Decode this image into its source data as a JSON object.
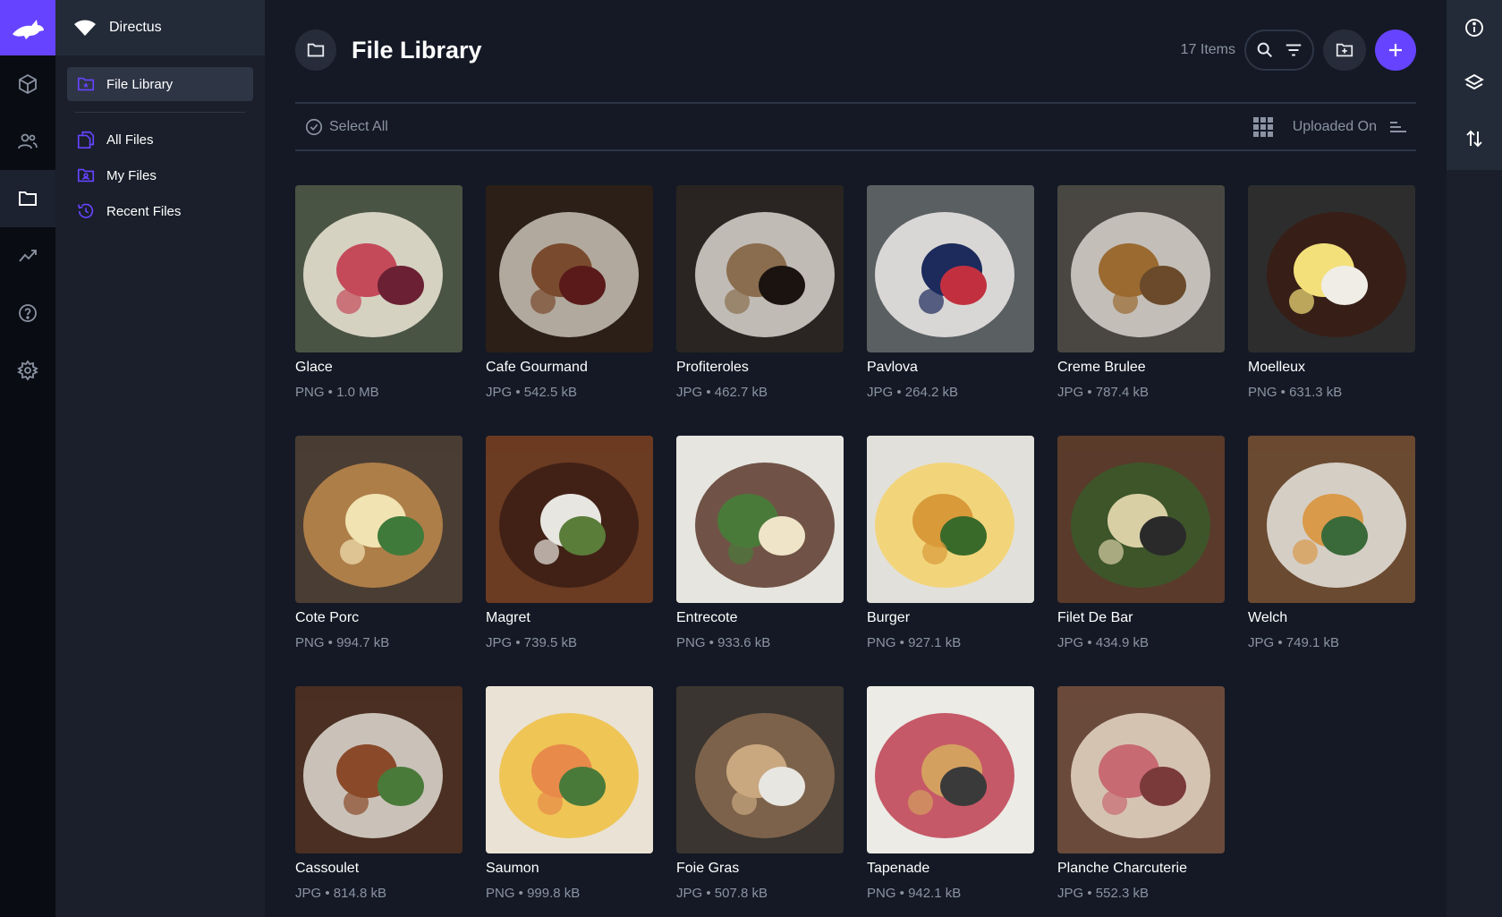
{
  "project": {
    "name": "Directus"
  },
  "modules": [
    "content-icon",
    "users-icon",
    "files-icon",
    "insights-icon",
    "help-icon",
    "settings-icon"
  ],
  "nav": {
    "header_item": "File Library",
    "items": [
      {
        "label": "All Files",
        "icon": "files-stack-icon"
      },
      {
        "label": "My Files",
        "icon": "user-folder-icon"
      },
      {
        "label": "Recent Files",
        "icon": "history-icon"
      }
    ]
  },
  "header": {
    "title": "File Library",
    "count": "17 Items"
  },
  "toolbar": {
    "select_all": "Select All",
    "sort_label": "Uploaded On"
  },
  "colors": {
    "accent": "#6644ff",
    "background": "#141925",
    "nav": "#1a1f2b",
    "modbar": "#090c12"
  },
  "files": [
    {
      "title": "Glace",
      "meta": "PNG • 1.0 MB"
    },
    {
      "title": "Cafe Gourmand",
      "meta": "JPG • 542.5 kB"
    },
    {
      "title": "Profiteroles",
      "meta": "JPG • 462.7 kB"
    },
    {
      "title": "Pavlova",
      "meta": "JPG • 264.2 kB"
    },
    {
      "title": "Creme Brulee",
      "meta": "JPG • 787.4 kB"
    },
    {
      "title": "Moelleux",
      "meta": "PNG • 631.3 kB"
    },
    {
      "title": "Cote Porc",
      "meta": "PNG • 994.7 kB"
    },
    {
      "title": "Magret",
      "meta": "JPG • 739.5 kB"
    },
    {
      "title": "Entrecote",
      "meta": "PNG • 933.6 kB"
    },
    {
      "title": "Burger",
      "meta": "PNG • 927.1 kB"
    },
    {
      "title": "Filet De Bar",
      "meta": "JPG • 434.9 kB"
    },
    {
      "title": "Welch",
      "meta": "JPG • 749.1 kB"
    },
    {
      "title": "Cassoulet",
      "meta": "JPG • 814.8 kB"
    },
    {
      "title": "Saumon",
      "meta": "PNG • 999.8 kB"
    },
    {
      "title": "Foie Gras",
      "meta": "JPG • 507.8 kB"
    },
    {
      "title": "Tapenade",
      "meta": "PNG • 942.1 kB"
    },
    {
      "title": "Planche Charcuterie",
      "meta": "JPG • 552.3 kB"
    }
  ]
}
